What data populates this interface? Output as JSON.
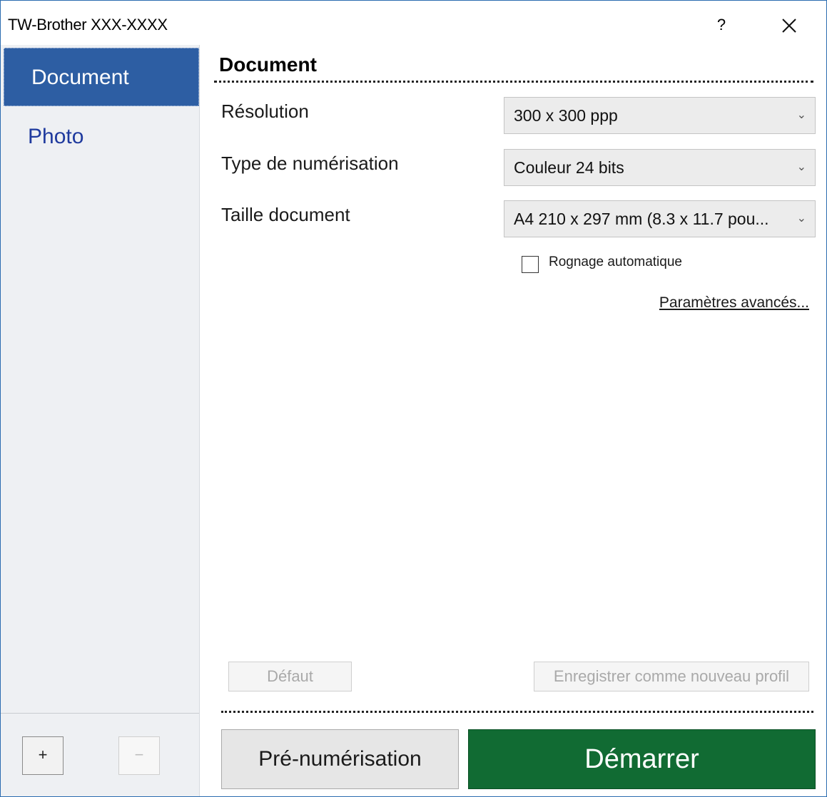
{
  "window": {
    "title": "TW-Brother XXX-XXXX",
    "help_label": "?"
  },
  "sidebar": {
    "items": [
      {
        "label": "Document",
        "active": true
      },
      {
        "label": "Photo",
        "active": false
      }
    ],
    "add_label": "+",
    "remove_label": "−"
  },
  "main": {
    "section_title": "Document",
    "fields": {
      "resolution": {
        "label": "Résolution",
        "value": "300 x 300 ppp"
      },
      "scan_type": {
        "label": "Type de numérisation",
        "value": "Couleur 24 bits"
      },
      "doc_size": {
        "label": "Taille document",
        "value": "A4 210 x 297 mm (8.3 x 11.7 pou..."
      }
    },
    "auto_crop": {
      "label": "Rognage automatique",
      "checked": false
    },
    "advanced_link": "Paramètres avancés...",
    "default_button": "Défaut",
    "save_profile_button": "Enregistrer comme nouveau profil",
    "prescan_button": "Pré-numérisation",
    "start_button": "Démarrer"
  },
  "colors": {
    "sidebar_active": "#2d5ea3",
    "sidebar_bg": "#eef0f3",
    "start_button": "#116b33",
    "link_text": "#1f3a9e"
  }
}
